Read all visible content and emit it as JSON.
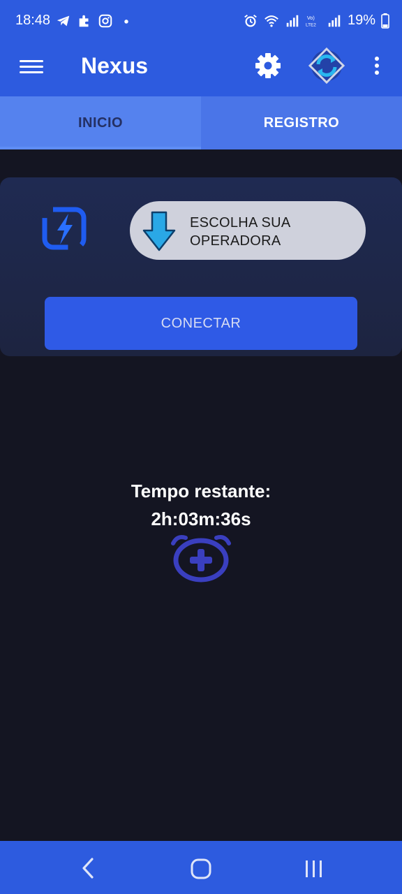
{
  "status_bar": {
    "time": "18:48",
    "notification_icons": [
      "telegram-icon",
      "puzzle-icon",
      "instagram-icon",
      "dot-icon"
    ],
    "status_icons": [
      "alarm-icon",
      "wifi-icon",
      "signal-icon",
      "volte-icon",
      "signal-icon"
    ],
    "battery": "19%"
  },
  "app_bar": {
    "title": "Nexus",
    "icons": [
      "menu-icon",
      "gear-icon",
      "sync-icon",
      "more-vert-icon"
    ]
  },
  "tabs": [
    {
      "label": "INICIO",
      "selected": true
    },
    {
      "label": "REGISTRO",
      "selected": false
    }
  ],
  "card": {
    "logo_icon": "link-bolt-logo",
    "operator_button": {
      "label": "ESCOLHA SUA OPERADORA",
      "icon": "download-arrow-icon"
    },
    "connect_button": {
      "label": "CONECTAR"
    }
  },
  "timer": {
    "label": "Tempo restante:",
    "value": "2h:03m:36s",
    "icon": "alarm-add-icon"
  },
  "nav_bar": {
    "icons": [
      "back-icon",
      "home-icon",
      "recents-icon"
    ]
  },
  "colors": {
    "primary": "#2d5bdf",
    "background": "#141522",
    "card": "#1f2a52",
    "alarm_icon": "#3a3fbf"
  }
}
